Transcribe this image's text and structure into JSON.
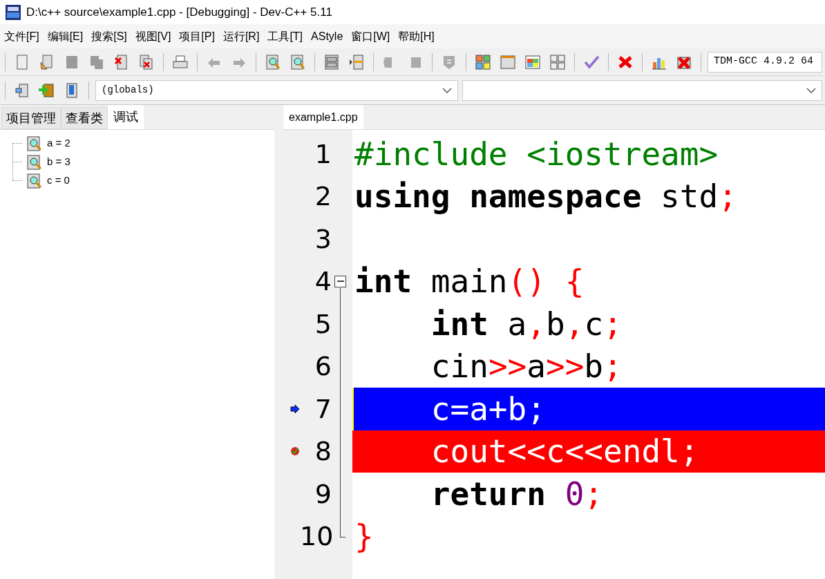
{
  "window": {
    "title": "D:\\c++ source\\example1.cpp - [Debugging] - Dev-C++ 5.11"
  },
  "menu": [
    "文件[F]",
    "编辑[E]",
    "搜索[S]",
    "视图[V]",
    "项目[P]",
    "运行[R]",
    "工具[T]",
    "AStyle",
    "窗口[W]",
    "帮助[H]"
  ],
  "toolbar": {
    "compiler": "TDM-GCC 4.9.2 64",
    "scope": "(globals)"
  },
  "left_tabs": [
    {
      "label": "项目管理",
      "selected": false
    },
    {
      "label": "查看类",
      "selected": false
    },
    {
      "label": "调试",
      "selected": true
    }
  ],
  "watches": [
    "a = 2",
    "b = 3",
    "c = 0"
  ],
  "editor_tabs": [
    {
      "label": "example1.cpp",
      "selected": true
    }
  ],
  "code": [
    {
      "number": "1",
      "kind": "plain",
      "current": false,
      "breakpoint": false,
      "tokens": [
        {
          "t": "#include <iostream>",
          "kind": "pre"
        }
      ]
    },
    {
      "number": "2",
      "kind": "plain",
      "current": false,
      "breakpoint": false,
      "tokens": [
        {
          "t": "using namespace",
          "kind": "kw"
        },
        {
          "t": " std",
          "kind": "id"
        },
        {
          "t": ";",
          "kind": "sym"
        }
      ]
    },
    {
      "number": "3",
      "kind": "plain",
      "current": false,
      "breakpoint": false
    },
    {
      "number": "4",
      "kind": "opener",
      "current": false,
      "breakpoint": false,
      "tokens": [
        {
          "t": "int",
          "kind": "kw"
        },
        {
          "t": " main",
          "kind": "id"
        },
        {
          "t": "() {",
          "kind": "sym"
        }
      ]
    },
    {
      "number": "5",
      "kind": "inner",
      "current": false,
      "breakpoint": false,
      "tokens": [
        {
          "t": "    int",
          "kind": "kw"
        },
        {
          "t": " a",
          "kind": "id"
        },
        {
          "t": ",",
          "kind": "sym"
        },
        {
          "t": "b",
          "kind": "id"
        },
        {
          "t": ",",
          "kind": "sym"
        },
        {
          "t": "c",
          "kind": "id"
        },
        {
          "t": ";",
          "kind": "sym"
        }
      ]
    },
    {
      "number": "6",
      "kind": "inner",
      "current": false,
      "breakpoint": false,
      "tokens": [
        {
          "t": "    cin",
          "kind": "id"
        },
        {
          "t": ">>",
          "kind": "sym"
        },
        {
          "t": "a",
          "kind": "id"
        },
        {
          "t": ">>",
          "kind": "sym"
        },
        {
          "t": "b",
          "kind": "id"
        },
        {
          "t": ";",
          "kind": "sym"
        }
      ]
    },
    {
      "number": "7",
      "kind": "inner",
      "current": true,
      "breakpoint": false,
      "tokens": [
        {
          "t": "    c=a+b;",
          "kind": "id"
        }
      ]
    },
    {
      "number": "8",
      "kind": "inner",
      "current": false,
      "breakpoint": true,
      "tokens": [
        {
          "t": "    cout<<c<<endl;",
          "kind": "id"
        }
      ]
    },
    {
      "number": "9",
      "kind": "inner",
      "current": false,
      "breakpoint": false,
      "tokens": [
        {
          "t": "    return",
          "kind": "kw"
        },
        {
          "t": " 0",
          "kind": "num"
        },
        {
          "t": ";",
          "kind": "sym"
        }
      ]
    },
    {
      "number": "10",
      "kind": "closer",
      "current": false,
      "breakpoint": false,
      "tokens": [
        {
          "t": "}",
          "kind": "sym"
        }
      ]
    }
  ]
}
